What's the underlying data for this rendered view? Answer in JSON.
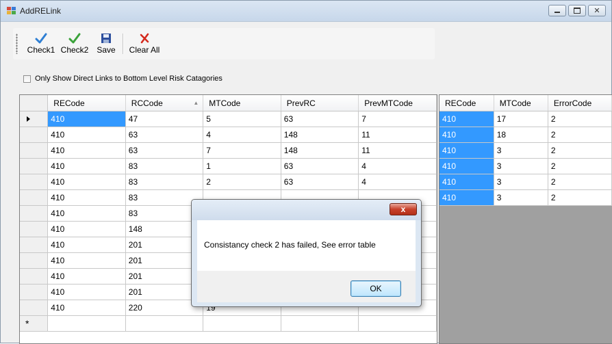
{
  "window": {
    "title": "AddRELink"
  },
  "toolbar": {
    "buttons": [
      {
        "label": "Check1",
        "icon": "checkmark-blue-icon"
      },
      {
        "label": "Check2",
        "icon": "checkmark-green-icon"
      },
      {
        "label": "Save",
        "icon": "floppy-disk-icon"
      },
      {
        "label": "Clear All",
        "icon": "red-x-icon"
      }
    ]
  },
  "filter": {
    "checkbox_label": "Only Show Direct Links to Bottom Level Risk Catagories",
    "checked": false
  },
  "main_grid": {
    "columns": [
      "RECode",
      "RCCode",
      "MTCode",
      "PrevRC",
      "PrevMTCode"
    ],
    "sorted_column": "RCCode",
    "rows": [
      [
        "410",
        "47",
        "5",
        "63",
        "7"
      ],
      [
        "410",
        "63",
        "4",
        "148",
        "11"
      ],
      [
        "410",
        "63",
        "7",
        "148",
        "11"
      ],
      [
        "410",
        "83",
        "1",
        "63",
        "4"
      ],
      [
        "410",
        "83",
        "2",
        "63",
        "4"
      ],
      [
        "410",
        "83",
        "",
        "",
        ""
      ],
      [
        "410",
        "83",
        "",
        "",
        ""
      ],
      [
        "410",
        "148",
        "",
        "",
        ""
      ],
      [
        "410",
        "201",
        "",
        "",
        ""
      ],
      [
        "410",
        "201",
        "",
        "",
        ""
      ],
      [
        "410",
        "201",
        "",
        "",
        ""
      ],
      [
        "410",
        "201",
        "",
        "",
        ""
      ],
      [
        "410",
        "220",
        "19",
        "",
        ""
      ]
    ],
    "new_row_marker": "*"
  },
  "error_grid": {
    "columns": [
      "RECode",
      "MTCode",
      "ErrorCode"
    ],
    "rows": [
      [
        "410",
        "17",
        "2"
      ],
      [
        "410",
        "18",
        "2"
      ],
      [
        "410",
        "3",
        "2"
      ],
      [
        "410",
        "3",
        "2"
      ],
      [
        "410",
        "3",
        "2"
      ],
      [
        "410",
        "3",
        "2"
      ]
    ]
  },
  "dialog": {
    "message": "Consistancy check 2 has failed, See error table",
    "ok_label": "OK",
    "close_glyph": "x"
  },
  "colors": {
    "selection": "#3399ff",
    "grid_empty": "#a0a0a0"
  }
}
